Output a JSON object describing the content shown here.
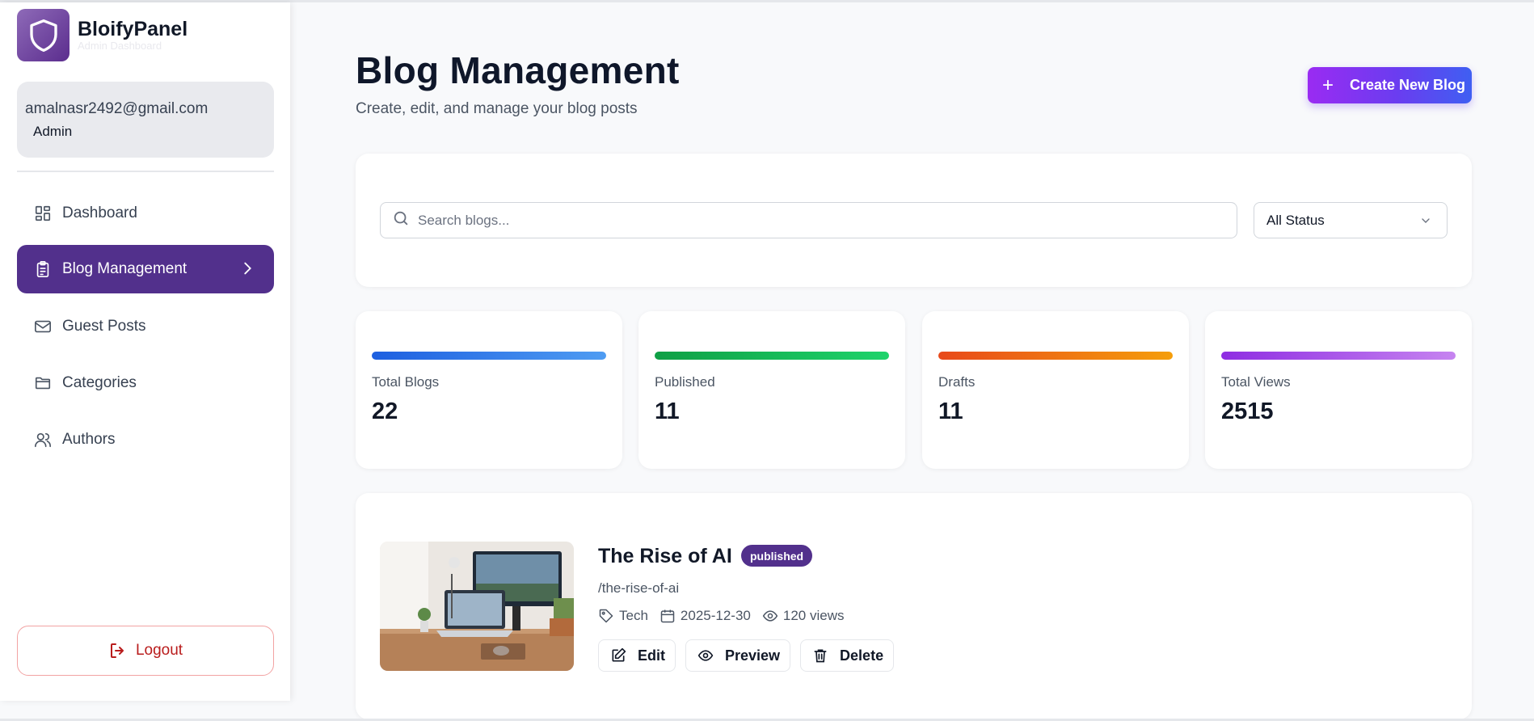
{
  "brand": {
    "name": "BloifyPanel",
    "subtitle": "Admin Dashboard"
  },
  "user": {
    "email": "amalnasr2492@gmail.com",
    "role": "Admin"
  },
  "sidebar": {
    "items": [
      {
        "label": "Dashboard",
        "icon": "layout-grid-icon"
      },
      {
        "label": "Blog Management",
        "icon": "clipboard-list-icon",
        "active": true
      },
      {
        "label": "Guest Posts",
        "icon": "mail-icon"
      },
      {
        "label": "Categories",
        "icon": "folder-icon"
      },
      {
        "label": "Authors",
        "icon": "users-icon"
      }
    ],
    "logout_label": "Logout"
  },
  "header": {
    "title": "Blog Management",
    "subtitle": "Create, edit, and manage your blog posts",
    "create_label": "Create New Blog"
  },
  "filters": {
    "search_placeholder": "Search blogs...",
    "status_selected": "All Status"
  },
  "stats": [
    {
      "label": "Total Blogs",
      "value": "22",
      "color_from": "#1d5fe0",
      "color_to": "#4f9cf2"
    },
    {
      "label": "Published",
      "value": "11",
      "color_from": "#0f9f45",
      "color_to": "#1ed36b"
    },
    {
      "label": "Drafts",
      "value": "11",
      "color_from": "#e8491a",
      "color_to": "#f59e0b"
    },
    {
      "label": "Total Views",
      "value": "2515",
      "color_from": "#8e2de2",
      "color_to": "#c684f0"
    }
  ],
  "blogs": [
    {
      "title": "The Rise of AI",
      "status": "published",
      "slug": "/the-rise-of-ai",
      "category": "Tech",
      "date": "2025-12-30",
      "views": "120 views",
      "actions": {
        "edit": "Edit",
        "preview": "Preview",
        "delete": "Delete"
      }
    }
  ],
  "colors": {
    "accent": "#52308c",
    "danger": "#b91c1c",
    "background": "#f8f9fb"
  }
}
